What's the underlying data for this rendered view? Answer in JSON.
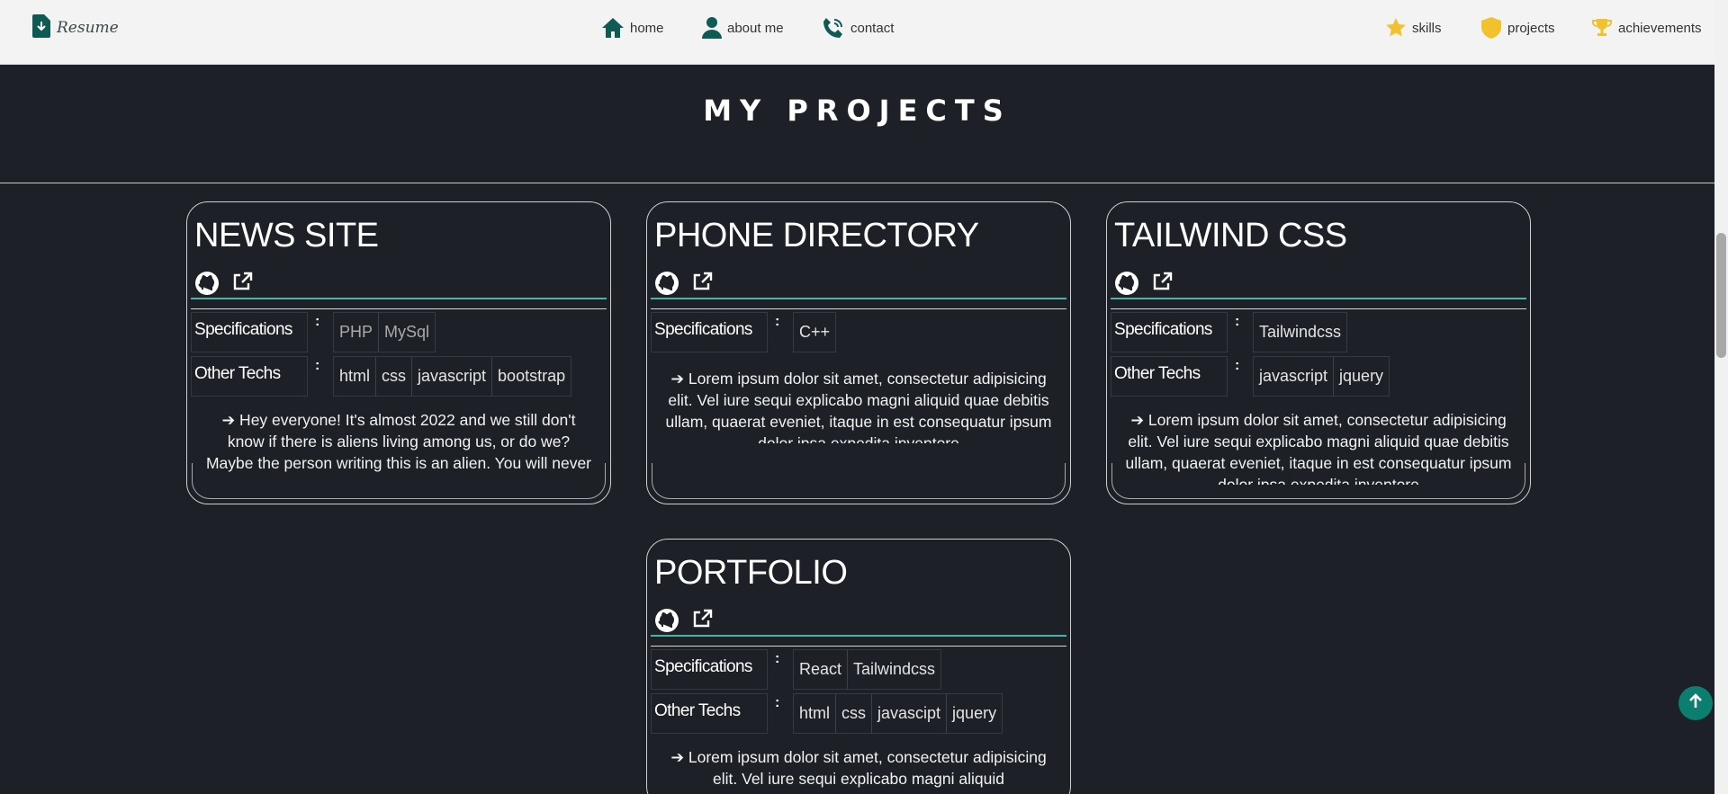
{
  "nav": {
    "brand": "Resume",
    "center": [
      {
        "icon": "home-icon",
        "label": "home"
      },
      {
        "icon": "user-icon",
        "label": "about me"
      },
      {
        "icon": "phone-icon",
        "label": "contact"
      }
    ],
    "right": [
      {
        "icon": "star-icon",
        "label": "skills"
      },
      {
        "icon": "shield-icon",
        "label": "projects"
      },
      {
        "icon": "trophy-icon",
        "label": "achievements"
      }
    ]
  },
  "section": {
    "title": "MY PROJECTS"
  },
  "projects": [
    {
      "title": "NEWS SITE",
      "spec_label": "Specifications",
      "spec_colon": ":",
      "specs": [
        "PHP",
        "MySql"
      ],
      "other_label": "Other Techs",
      "other_colon": ":",
      "others": [
        "html",
        "css",
        "javascript",
        "bootstrap"
      ],
      "description": "➔ Hey everyone! It's almost 2022 and we still don't know if there is aliens living among us, or do we? Maybe the person writing this is an alien. You will never know."
    },
    {
      "title": "PHONE DIRECTORY",
      "spec_label": "Specifications",
      "spec_colon": ":",
      "specs": [
        "C++"
      ],
      "description": "➔ Lorem ipsum dolor sit amet, consectetur adipisicing elit. Vel iure sequi explicabo magni aliquid quae debitis ullam, quaerat eveniet, itaque in est consequatur ipsum dolor ipsa expedita inventore"
    },
    {
      "title": "TAILWIND CSS",
      "spec_label": "Specifications",
      "spec_colon": ":",
      "specs": [
        "Tailwindcss"
      ],
      "other_label": "Other Techs",
      "other_colon": ":",
      "others": [
        "javascript",
        "jquery"
      ],
      "description": "➔ Lorem ipsum dolor sit amet, consectetur adipisicing elit. Vel iure sequi explicabo magni aliquid quae debitis ullam, quaerat eveniet, itaque in est consequatur ipsum dolor ipsa expedita inventore"
    },
    {
      "title": "PORTFOLIO",
      "spec_label": "Specifications",
      "spec_colon": ":",
      "specs": [
        "React",
        "Tailwindcss"
      ],
      "other_label": "Other Techs",
      "other_colon": ":",
      "others": [
        "html",
        "css",
        "javascipt",
        "jquery"
      ],
      "description": "➔ Lorem ipsum dolor sit amet, consectetur adipisicing elit. Vel iure sequi explicabo magni aliquid"
    }
  ],
  "colors": {
    "page_bg": "#1d2026",
    "navbar_bg": "#f3f3f3",
    "accent_teal": "#4ab5a5",
    "brand_dark_teal": "#0e5a55",
    "star_gold": "#f2c12e"
  }
}
